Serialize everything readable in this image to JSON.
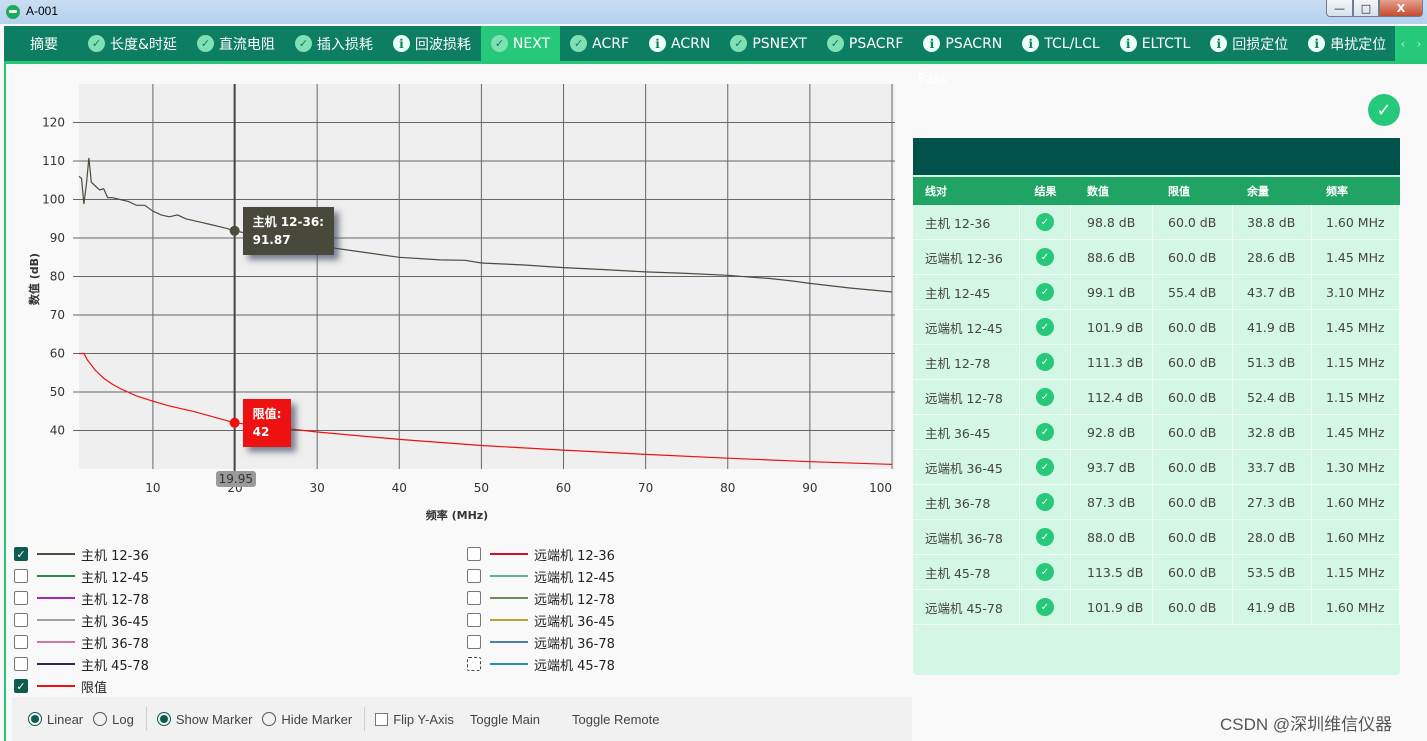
{
  "window": {
    "title": "A-001",
    "controls": {
      "minimize": "—",
      "maximize": "□",
      "close": "X"
    }
  },
  "tabs": [
    {
      "label": "摘要",
      "icon": "none",
      "active": false
    },
    {
      "label": "长度&时延",
      "icon": "check",
      "active": false
    },
    {
      "label": "直流电阻",
      "icon": "check",
      "active": false
    },
    {
      "label": "插入损耗",
      "icon": "check",
      "active": false
    },
    {
      "label": "回波损耗",
      "icon": "info",
      "active": false
    },
    {
      "label": "NEXT",
      "icon": "check",
      "active": true
    },
    {
      "label": "ACRF",
      "icon": "check",
      "active": false
    },
    {
      "label": "ACRN",
      "icon": "info",
      "active": false
    },
    {
      "label": "PSNEXT",
      "icon": "check",
      "active": false
    },
    {
      "label": "PSACRF",
      "icon": "check",
      "active": false
    },
    {
      "label": "PSACRN",
      "icon": "info",
      "active": false
    },
    {
      "label": "TCL/LCL",
      "icon": "info",
      "active": false
    },
    {
      "label": "ELTCTL",
      "icon": "info",
      "active": false
    },
    {
      "label": "回损定位",
      "icon": "info",
      "active": false
    },
    {
      "label": "串扰定位",
      "icon": "info",
      "active": false
    },
    {
      "label": "",
      "icon": "info",
      "active": false
    }
  ],
  "tab_scroll": {
    "prev": "‹",
    "next": "›"
  },
  "chart_data": {
    "type": "line",
    "title": "",
    "xlabel": "频率 (MHz)",
    "ylabel": "数值 (dB)",
    "xlim": [
      1,
      100
    ],
    "ylim": [
      30,
      130
    ],
    "x_ticks": [
      10,
      20,
      30,
      40,
      50,
      60,
      70,
      80,
      90,
      100
    ],
    "y_ticks": [
      40,
      50,
      60,
      70,
      80,
      90,
      100,
      110,
      120
    ],
    "grid": true,
    "marker": {
      "x": 19.95,
      "x_label": "19.95"
    },
    "series": [
      {
        "name": "主机 12-36",
        "color": "#4a4d3c",
        "x": [
          1,
          1.3,
          1.6,
          1.9,
          2.2,
          2.5,
          3,
          3.5,
          4,
          4.5,
          5,
          6,
          7,
          8,
          9,
          10,
          11,
          12,
          13,
          14,
          15,
          16,
          17,
          18,
          19,
          19.95,
          22,
          25,
          28,
          30,
          35,
          40,
          45,
          48,
          50,
          55,
          60,
          65,
          70,
          75,
          80,
          83,
          85,
          88,
          90,
          95,
          100
        ],
        "values": [
          106,
          105.5,
          98.8,
          104,
          110.8,
          104.5,
          103.5,
          102.5,
          102.8,
          100.5,
          100.5,
          100,
          99.5,
          98.5,
          98.5,
          97,
          96,
          95.5,
          96,
          95,
          94.5,
          94,
          93.5,
          93,
          92.5,
          91.87,
          91,
          89.5,
          88.5,
          88,
          86.5,
          85,
          84.3,
          84.2,
          83.5,
          83,
          82.3,
          81.8,
          81.2,
          80.8,
          80.3,
          79.8,
          79.5,
          78.8,
          78.2,
          77,
          76
        ]
      },
      {
        "name": "限值",
        "color": "#ee1111",
        "x": [
          1,
          1.6,
          2,
          3,
          4,
          5,
          6,
          8,
          10,
          12,
          15,
          19.95,
          25,
          30,
          40,
          50,
          60,
          70,
          80,
          90,
          100
        ],
        "values": [
          60,
          60,
          58.4,
          55.6,
          53.6,
          52.1,
          50.9,
          49,
          47.6,
          46.4,
          44.9,
          42,
          40.8,
          39.6,
          37.7,
          36.1,
          34.9,
          33.8,
          32.8,
          31.9,
          31.2
        ]
      }
    ],
    "tooltips": [
      {
        "series": "主机 12-36",
        "label": "主机 12-36:",
        "value": "91.87"
      },
      {
        "series": "限值",
        "label": "限值:",
        "value": "42"
      }
    ]
  },
  "legend": {
    "left": [
      {
        "label": "主机 12-36",
        "color": "#4a4d3c",
        "checked": true
      },
      {
        "label": "主机 12-45",
        "color": "#2e8b47",
        "checked": false
      },
      {
        "label": "主机 12-78",
        "color": "#9b2fae",
        "checked": false
      },
      {
        "label": "主机 36-45",
        "color": "#a79aa8",
        "checked": false
      },
      {
        "label": "主机 36-78",
        "color": "#c77aa3",
        "checked": false
      },
      {
        "label": "主机 45-78",
        "color": "#2b2a4c",
        "checked": false
      },
      {
        "label": "限值",
        "color": "#ee1111",
        "checked": true
      }
    ],
    "right": [
      {
        "label": "远端机 12-36",
        "color": "#c8102e",
        "checked": false
      },
      {
        "label": "远端机 12-45",
        "color": "#5cb88a",
        "checked": false
      },
      {
        "label": "远端机 12-78",
        "color": "#6f8a5e",
        "checked": false
      },
      {
        "label": "远端机 36-45",
        "color": "#b5a33a",
        "checked": false
      },
      {
        "label": "远端机 36-78",
        "color": "#4f7fa6",
        "checked": false
      },
      {
        "label": "远端机 45-78",
        "color": "#2a8fa3",
        "checked": false
      }
    ]
  },
  "toolbar": {
    "linear": "Linear",
    "log": "Log",
    "scale_selected": "Linear",
    "show_marker": "Show Marker",
    "hide_marker": "Hide Marker",
    "marker_selected": "Show Marker",
    "flip_y": "Flip Y-Axis",
    "flip_y_checked": false,
    "toggle_main": "Toggle Main",
    "toggle_remote": "Toggle Remote"
  },
  "result": {
    "status_text": "Pass",
    "status": "pass"
  },
  "table": {
    "headers": [
      "线对",
      "结果",
      "数值",
      "限值",
      "余量",
      "频率"
    ],
    "rows": [
      {
        "pair": "主机 12-36",
        "result": "pass",
        "value": "98.8 dB",
        "limit": "60.0 dB",
        "margin": "38.8 dB",
        "freq": "1.60 MHz"
      },
      {
        "pair": "远端机 12-36",
        "result": "pass",
        "value": "88.6 dB",
        "limit": "60.0 dB",
        "margin": "28.6 dB",
        "freq": "1.45 MHz"
      },
      {
        "pair": "主机 12-45",
        "result": "pass",
        "value": "99.1 dB",
        "limit": "55.4 dB",
        "margin": "43.7 dB",
        "freq": "3.10 MHz"
      },
      {
        "pair": "远端机 12-45",
        "result": "pass",
        "value": "101.9 dB",
        "limit": "60.0 dB",
        "margin": "41.9 dB",
        "freq": "1.45 MHz"
      },
      {
        "pair": "主机 12-78",
        "result": "pass",
        "value": "111.3 dB",
        "limit": "60.0 dB",
        "margin": "51.3 dB",
        "freq": "1.15 MHz"
      },
      {
        "pair": "远端机 12-78",
        "result": "pass",
        "value": "112.4 dB",
        "limit": "60.0 dB",
        "margin": "52.4 dB",
        "freq": "1.15 MHz"
      },
      {
        "pair": "主机 36-45",
        "result": "pass",
        "value": "92.8 dB",
        "limit": "60.0 dB",
        "margin": "32.8 dB",
        "freq": "1.45 MHz"
      },
      {
        "pair": "远端机 36-45",
        "result": "pass",
        "value": "93.7 dB",
        "limit": "60.0 dB",
        "margin": "33.7 dB",
        "freq": "1.30 MHz"
      },
      {
        "pair": "主机 36-78",
        "result": "pass",
        "value": "87.3 dB",
        "limit": "60.0 dB",
        "margin": "27.3 dB",
        "freq": "1.60 MHz"
      },
      {
        "pair": "远端机 36-78",
        "result": "pass",
        "value": "88.0 dB",
        "limit": "60.0 dB",
        "margin": "28.0 dB",
        "freq": "1.60 MHz"
      },
      {
        "pair": "主机 45-78",
        "result": "pass",
        "value": "113.5 dB",
        "limit": "60.0 dB",
        "margin": "53.5 dB",
        "freq": "1.15 MHz"
      },
      {
        "pair": "远端机 45-78",
        "result": "pass",
        "value": "101.9 dB",
        "limit": "60.0 dB",
        "margin": "41.9 dB",
        "freq": "1.60 MHz"
      }
    ]
  },
  "watermark": "CSDN @深圳维信仪器"
}
